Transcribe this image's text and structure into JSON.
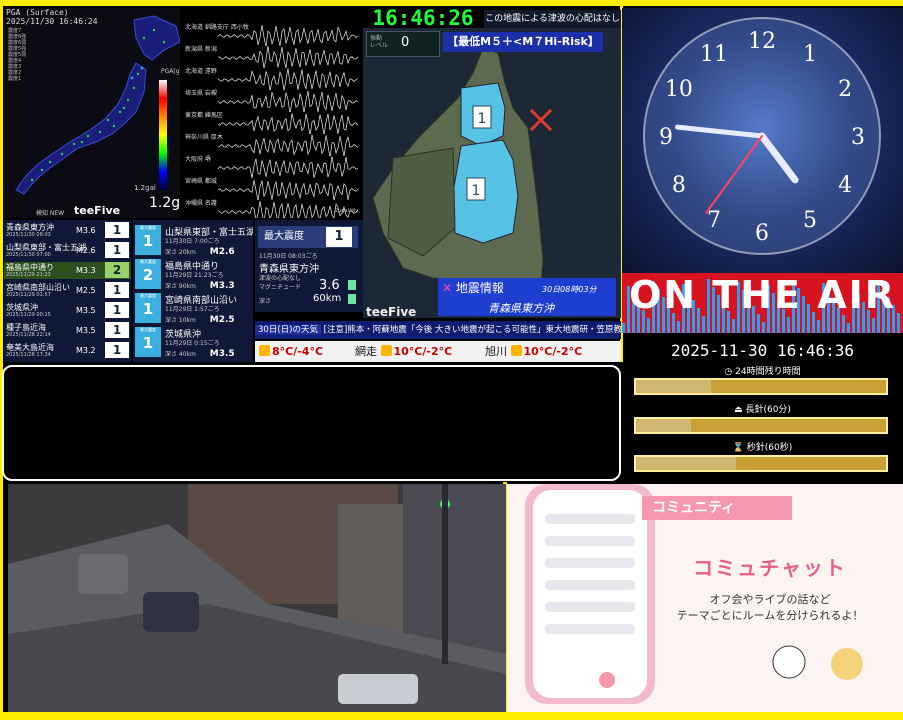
{
  "colors": {
    "frame": "#ffee00",
    "digital_clock": "#1cff3a",
    "onair_red": "#d8131f",
    "quake_blue": "#1e3ecf",
    "intensity_light_blue": "#56c2e6"
  },
  "seismic_map": {
    "header_line1": "PGA (Surface)",
    "header_line2": "2025/11/30 16:46:24",
    "legend": [
      "震度7",
      "震度6強",
      "震度6弱",
      "震度5強",
      "震度5弱",
      "震度4",
      "震度3",
      "震度2",
      "震度1"
    ],
    "scale_label": "PGA[gal]",
    "low_label": "1.2gal",
    "gal_value": "1.2gal",
    "small_label": "検知 NEW",
    "brand": "teeFive"
  },
  "waveforms": [
    {
      "label": "北海道 釧路支庁 西小牧"
    },
    {
      "label": "新潟県 新潟"
    },
    {
      "label": "北海道 遠野"
    },
    {
      "label": "埼玉県 岩槻"
    },
    {
      "label": "東京都 練馬区"
    },
    {
      "label": "神奈川県 厚木"
    },
    {
      "label": "大阪府 堺"
    },
    {
      "label": "宮崎県 都城"
    },
    {
      "label": "沖縄県 名護"
    }
  ],
  "waveform_unit": "2μgal/div",
  "digital_clock": "16:46:26",
  "notice": "この地震による津波の心配はなし",
  "quake": {
    "level_label": "振動\nレベル",
    "level_value": "0",
    "risk_label": "【最低M５＋<M７Hi-Risk】",
    "intensity_a": "1",
    "intensity_b": "1",
    "info_title": "地震情報",
    "info_time": "30日08時03分",
    "info_place": "青森県東方沖",
    "brand": "teeFive"
  },
  "quake_list": [
    {
      "name": "青森県東方沖",
      "time": "2025/11/30 08:03",
      "mag": "M3.6",
      "scale": "1"
    },
    {
      "name": "山梨県東部・富士五湖",
      "time": "2025/11/30 07:00",
      "mag": "M2.6",
      "scale": "1"
    },
    {
      "name": "福島県中通り",
      "time": "2025/11/29 21:23",
      "mag": "M3.3",
      "scale": "2"
    },
    {
      "name": "宮崎県南部山沿い",
      "time": "2025/11/29 01:57",
      "mag": "M2.5",
      "scale": "1"
    },
    {
      "name": "茨城県沖",
      "time": "2025/11/29 00:15",
      "mag": "M3.5",
      "scale": "1"
    },
    {
      "name": "種子島近海",
      "time": "2025/11/28 22:14",
      "mag": "M3.5",
      "scale": "1"
    },
    {
      "name": "奄美大島近海",
      "time": "2025/11/28 17:34",
      "mag": "M3.2",
      "scale": "1"
    }
  ],
  "quake_detail": [
    {
      "badge": "最大震度",
      "scale": "1",
      "place": "山梨県東部・富士五湖",
      "date": "11月30日 7:00ごろ",
      "depth": "深さ 20km",
      "mag": "M2.6"
    },
    {
      "badge": "最大震度",
      "scale": "2",
      "place": "福島県中通り",
      "date": "11月29日 21:23ごろ",
      "depth": "深さ 90km",
      "mag": "M3.3"
    },
    {
      "badge": "最大震度",
      "scale": "1",
      "place": "宮崎県南部山沿い",
      "date": "11月29日 1:57ごろ",
      "depth": "深さ 10km",
      "mag": "M2.5"
    },
    {
      "badge": "最大震度",
      "scale": "1",
      "place": "茨城県沖",
      "date": "11月29日 0:15ごろ",
      "depth": "深さ 40km",
      "mag": "M3.5"
    }
  ],
  "max_panel": {
    "title": "最大震度",
    "value": "1",
    "date": "11月30日 08:03ごろ",
    "place": "青森県東方沖",
    "tsunami": "津波の心配なし",
    "mag_label": "マグニチュード",
    "mag": "3.6",
    "depth_label": "深さ",
    "depth": "60km"
  },
  "ticker": {
    "date": "30日(日)の天気",
    "text": "[注意]熊本・阿蘇地震「今後 大きい地震が起こる可能性」東大地震研・笠原教授"
  },
  "weather": [
    {
      "city": "",
      "temp": "8°C/-4°C"
    },
    {
      "city": "網走",
      "temp": "10°C/-2°C"
    },
    {
      "city": "旭川",
      "temp": "10°C/-2°C"
    }
  ],
  "analog_clock": {
    "numbers": [
      "12",
      "1",
      "2",
      "3",
      "4",
      "5",
      "6",
      "7",
      "8",
      "9",
      "10",
      "11"
    ],
    "hour": 4,
    "minute": 46,
    "second": 36
  },
  "onair": "ON THE AIR",
  "datetime": "2025-11-30 16:46:36",
  "progress": [
    {
      "label": "24時間残り時間",
      "fraction": 0.3
    },
    {
      "label": "長針(60分)",
      "fraction": 0.22
    },
    {
      "label": "秒針(60秒)",
      "fraction": 0.4
    }
  ],
  "promo": {
    "tag": "コミュニティ",
    "title": "コミュチャット",
    "desc_line1": "オフ会やライブの話など",
    "desc_line2": "テーマごとにルームを分けられるよ！"
  }
}
